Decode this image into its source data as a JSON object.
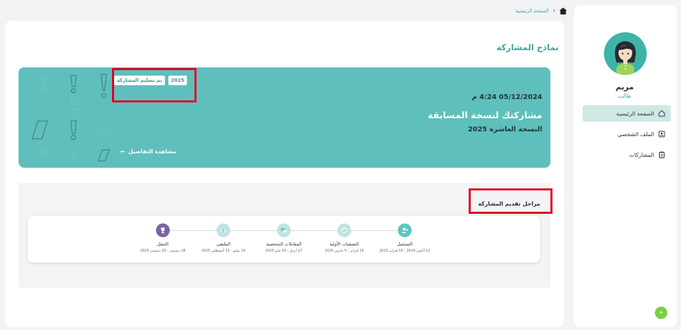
{
  "breadcrumb": {
    "home_icon": "home-icon",
    "current": "الصفحة الرئيسية"
  },
  "sidebar": {
    "user_name": "مريم",
    "user_role": "طالب",
    "items": [
      {
        "label": "الصفحة الرئيسية",
        "icon": "home-outline-icon",
        "active": true
      },
      {
        "label": "الملف الشخصي",
        "icon": "profile-card-icon",
        "active": false
      },
      {
        "label": "المشاركات",
        "icon": "clipboard-icon",
        "active": false
      }
    ],
    "collapse_icon": "double-chevron-icon"
  },
  "main": {
    "title": "نماذج المشاركة",
    "banner": {
      "badge_status": "تم تسليم المشاركة",
      "badge_year": "2025",
      "date": "05/12/2024 4:24 م",
      "title": "مشاركتك لنسخة المسابقة",
      "subtitle": "النسخة العاشرة 2025",
      "details_link": "مشاهدة التفاصيل"
    },
    "stages": {
      "title": "مراحل تقديم المشاركة",
      "steps": [
        {
          "label": "التسجيل",
          "date": "12 أكتوبر 2024 - 15 فبراير 2025",
          "icon": "user-plus-icon",
          "color": "#5fc7c2"
        },
        {
          "label": "التصفيات الأولية",
          "date": "16 فبراير - 5 مارس 2025",
          "icon": "check-circle-icon",
          "color": "#bfe4e2"
        },
        {
          "label": "المقابلات الشخصية",
          "date": "27 أبريل - 10 مايو 2025",
          "icon": "chat-icon",
          "color": "#bfe4e2"
        },
        {
          "label": "الملتقى",
          "date": "19 يوليو - 15 أغسطس 2025",
          "icon": "eye-icon",
          "color": "#bfe4e2"
        },
        {
          "label": "الحفل",
          "date": "18 ديسمبر - 20 ديسمبر 2025",
          "icon": "trophy-icon",
          "color": "#7a63a8"
        }
      ]
    }
  }
}
